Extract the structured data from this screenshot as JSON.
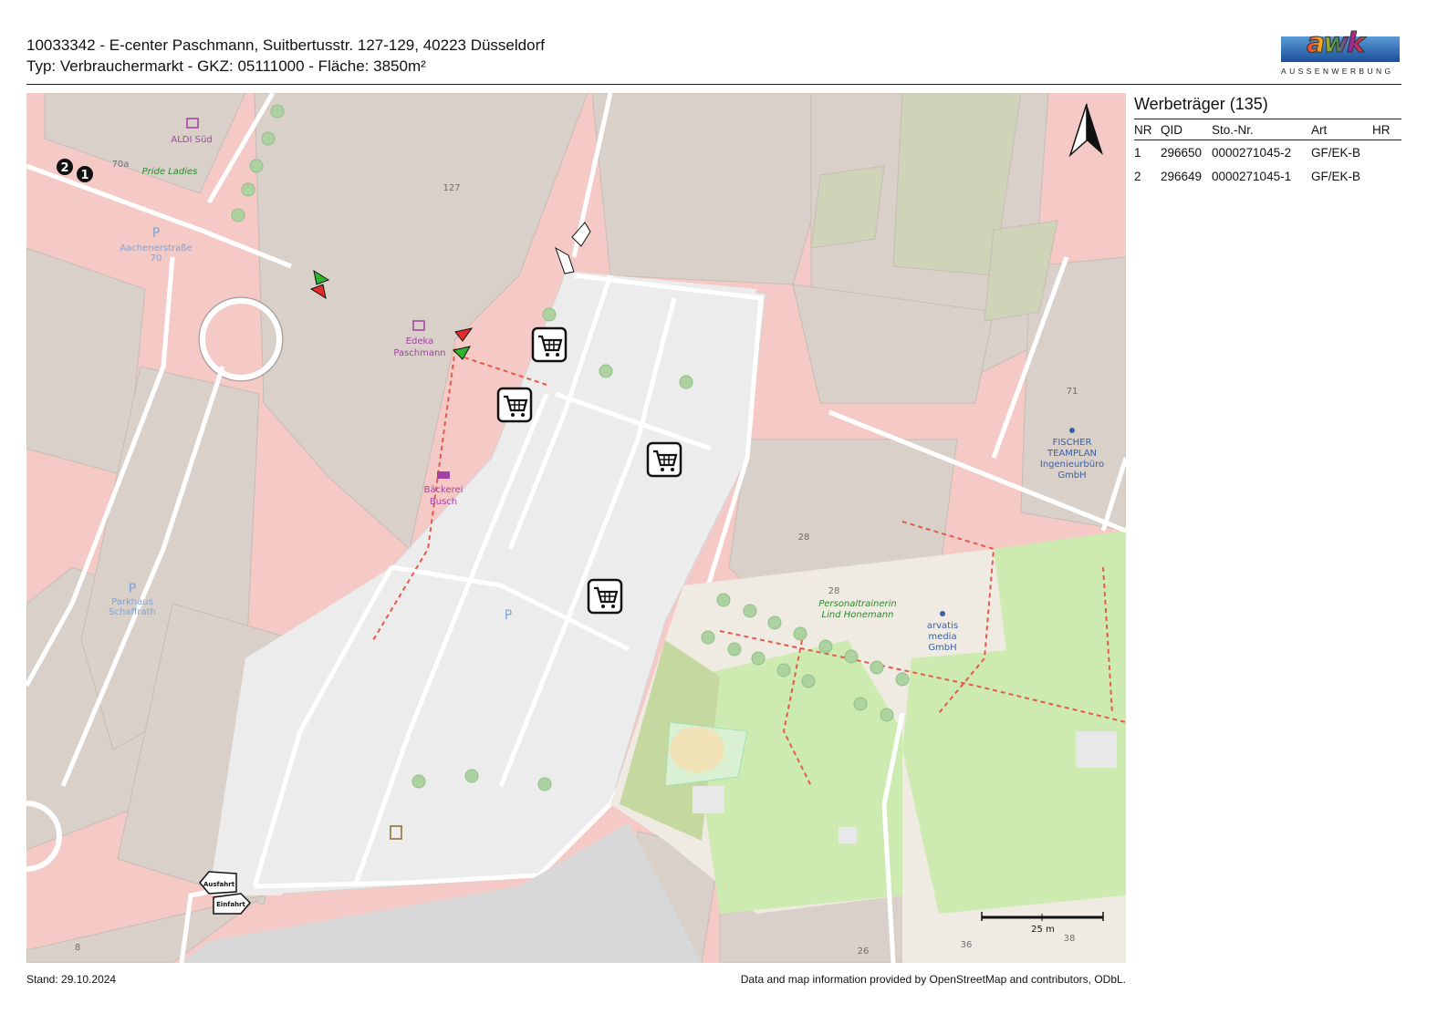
{
  "header": {
    "line1": "10033342 - E-center Paschmann, Suitbertusstr. 127-129, 40223 Düsseldorf",
    "line2": "Typ: Verbrauchermarkt - GKZ: 05111000 - Fläche: 3850m²"
  },
  "logo": {
    "word": "awk",
    "sub": "AUSSENWERBUNG"
  },
  "panel": {
    "title": "Werbeträger (135)",
    "columns": [
      "NR",
      "QID",
      "Sto.-Nr.",
      "Art",
      "HR"
    ],
    "rows": [
      {
        "nr": "1",
        "qid": "296650",
        "sto": "0000271045-2",
        "art": "GF/EK-B",
        "hr": ""
      },
      {
        "nr": "2",
        "qid": "296649",
        "sto": "0000271045-1",
        "art": "GF/EK-B",
        "hr": ""
      }
    ]
  },
  "map": {
    "labels": {
      "aldi": "ALDI Süd",
      "pride": "Pride Ladies",
      "h70a": "70a",
      "h127": "127",
      "aachener": "Aachenerstraße",
      "h70": "70",
      "edeka1": "Edeka",
      "edeka2": "Paschmann",
      "baeckerei1": "Bäckerei",
      "baeckerei2": "Busch",
      "parkhaus1": "Parkhaus",
      "parkhaus2": "Schaffrath",
      "p_main": "P",
      "h71": "71",
      "fischer1": "FISCHER",
      "fischer2": "TEAMPLAN",
      "fischer3": "Ingenieurbüro",
      "fischer4": "GmbH",
      "h28a": "28",
      "h28b": "28",
      "personal1": "Personaltrainerin",
      "personal2": "Lind Honemann",
      "arvatis1": "arvatis",
      "arvatis2": "media",
      "arvatis3": "GmbH",
      "h8": "8",
      "h26": "26",
      "h36": "36",
      "h38": "38",
      "scale": "25 m",
      "ausfahrt": "Ausfahrt",
      "einfahrt": "Einfahrt"
    },
    "markers": [
      "1",
      "2"
    ],
    "icons": [
      "shopping-cart-icon",
      "north-arrow-icon",
      "ausfahrt-sign-icon",
      "einfahrt-sign-icon",
      "advertising-board-arrow-icon"
    ]
  },
  "footer": {
    "stand": "Stand: 29.10.2024",
    "attribution": "Data and map information provided by OpenStreetMap and contributors, ODbL."
  }
}
